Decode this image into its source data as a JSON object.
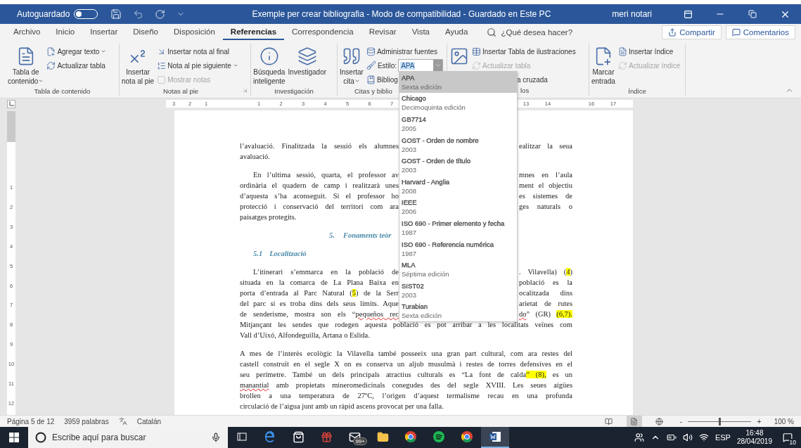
{
  "title_bar": {
    "autosave_label": "Autoguardado",
    "autosave_on": false,
    "undo_disabled": true,
    "title": "Exemple per crear bibliografia - Modo de compatibilidad - Guardado en Este PC",
    "user": "meri notari"
  },
  "menu_tabs": [
    {
      "label": "Archivo",
      "selected": false
    },
    {
      "label": "Inicio",
      "selected": false
    },
    {
      "label": "Insertar",
      "selected": false
    },
    {
      "label": "Diseño",
      "selected": false
    },
    {
      "label": "Disposición",
      "selected": false
    },
    {
      "label": "Referencias",
      "selected": true
    },
    {
      "label": "Correspondencia",
      "selected": false
    },
    {
      "label": "Revisar",
      "selected": false
    },
    {
      "label": "Vista",
      "selected": false
    },
    {
      "label": "Ayuda",
      "selected": false
    }
  ],
  "search": {
    "placeholder": "¿Qué desea hacer?"
  },
  "share_button": "Compartir",
  "comments_button": "Comentarios",
  "ribbon_groups": [
    {
      "label": "Tabla de contenido",
      "launcher": false,
      "items": [
        {
          "kind": "large",
          "lines": [
            "Tabla de",
            "contenido"
          ],
          "dropdown": true
        },
        {
          "kind": "stack",
          "buttons": [
            {
              "kind": "button",
              "label": "Agregar texto",
              "dropdown": true,
              "disabled": false
            },
            {
              "kind": "button",
              "label": "Actualizar tabla",
              "dropdown": false,
              "disabled": false
            }
          ]
        }
      ]
    },
    {
      "label": "Notas al pie",
      "launcher": true,
      "items": [
        {
          "kind": "large",
          "lines": [
            "Insertar",
            "nota al pie"
          ],
          "dropdown": false
        },
        {
          "kind": "stack",
          "buttons": [
            {
              "kind": "button",
              "label": "Insertar nota al final",
              "dropdown": false,
              "disabled": false
            },
            {
              "kind": "button",
              "label": "Nota al pie siguiente",
              "dropdown": true,
              "disabled": false
            },
            {
              "kind": "button",
              "label": "Mostrar notas",
              "dropdown": false,
              "disabled": true
            }
          ]
        }
      ]
    },
    {
      "label": "Investigación",
      "launcher": false,
      "items": [
        {
          "kind": "large",
          "lines": [
            "Búsqueda",
            "inteligente"
          ],
          "dropdown": false
        },
        {
          "kind": "large",
          "lines": [
            "Investigador"
          ],
          "dropdown": false
        }
      ]
    },
    {
      "label": "Citas y biblio",
      "launcher": false,
      "items": [
        {
          "kind": "large",
          "lines": [
            "Insertar",
            "cita"
          ],
          "dropdown": true
        },
        {
          "kind": "stack",
          "buttons": [
            {
              "kind": "button",
              "label": "Administrar fuentes",
              "dropdown": false,
              "disabled": false
            },
            {
              "kind": "style",
              "label": "Estilo:",
              "value": "APA",
              "expanded": true,
              "options": [
                {
                  "name": "APA",
                  "detail": "Sexta edición",
                  "selected": true
                },
                {
                  "name": "Chicago",
                  "detail": "Decimoquinta edición",
                  "selected": false
                },
                {
                  "name": "GB7714",
                  "detail": "2005",
                  "selected": false
                },
                {
                  "name": "GOST - Orden de nombre",
                  "detail": "2003",
                  "selected": false
                },
                {
                  "name": "GOST - Orden de título",
                  "detail": "2003",
                  "selected": false
                },
                {
                  "name": "Harvard - Anglia",
                  "detail": "2008",
                  "selected": false
                },
                {
                  "name": "IEEE",
                  "detail": "2006",
                  "selected": false
                },
                {
                  "name": "ISO 690 - Primer elemento y fecha",
                  "detail": "1987",
                  "selected": false
                },
                {
                  "name": "ISO 690 - Referencia numérica",
                  "detail": "1987",
                  "selected": false
                },
                {
                  "name": "MLA",
                  "detail": "Séptima edición",
                  "selected": false
                },
                {
                  "name": "SIST02",
                  "detail": "2003",
                  "selected": false
                },
                {
                  "name": "Turabian",
                  "detail": "Sexta edición",
                  "selected": false
                }
              ]
            },
            {
              "kind": "button",
              "label": "Bibliog",
              "disabled": false
            }
          ]
        }
      ]
    },
    {
      "label": "los",
      "launcher": false,
      "items": [
        {
          "kind": "large"
        },
        {
          "kind": "stack",
          "buttons": [
            {
              "kind": "button",
              "label": "Insertar Tabla de ilustraciones",
              "dropdown": false,
              "disabled": false
            },
            {
              "kind": "button",
              "label": "Actualizar tabla",
              "dropdown": false,
              "disabled": true
            },
            {
              "kind": "clipped",
              "label": "a cruzada",
              "dropdown": false,
              "disabled": false
            }
          ]
        }
      ]
    },
    {
      "label": "Índice",
      "launcher": false,
      "items": [
        {
          "kind": "large",
          "lines": [
            "Marcar",
            "entrada"
          ],
          "dropdown": false
        },
        {
          "kind": "stack",
          "buttons": [
            {
              "kind": "button",
              "label": "Insertar índice",
              "dropdown": false,
              "disabled": false
            },
            {
              "kind": "button",
              "label": "Actualizar índice",
              "dropdown": false,
              "disabled": true
            }
          ]
        }
      ]
    }
  ],
  "ruler": [
    [
      "3",
      "2",
      "1"
    ],
    [
      "1",
      "2",
      "3",
      "4",
      "5",
      "6",
      "7"
    ],
    [
      "13",
      "14"
    ],
    [
      "16",
      "17"
    ]
  ],
  "vertical_ruler": [
    "1",
    "2",
    "3",
    "4",
    "5",
    "6",
    "7",
    "8",
    "9",
    "10",
    "11",
    "12"
  ],
  "document": [
    {
      "kind": "paragraph",
      "indented": false,
      "lines": [
        {
          "left": [
            {
              "kind": "plain",
              "text": "l’avaluació. Finalitzada la sessió els alumnes"
            }
          ],
          "right": [
            {
              "kind": "plain",
              "text": "ealitzar la seua"
            }
          ]
        },
        {
          "left": [
            {
              "kind": "plain",
              "text": "avaluació."
            }
          ]
        }
      ]
    },
    {
      "kind": "paragraph",
      "indented": true,
      "lines": [
        {
          "left": [
            {
              "kind": "plain",
              "text": "En l’ultima sessió, quarta, el professor av"
            }
          ],
          "right": [
            {
              "kind": "plain",
              "text": "mnes en l’aula"
            }
          ]
        },
        {
          "left": [
            {
              "kind": "plain",
              "text": "ordinària el quadern de camp i realitzarà unes"
            }
          ],
          "right": [
            {
              "kind": "plain",
              "text": "ment el objectiu"
            }
          ]
        },
        {
          "left": [
            {
              "kind": "plain",
              "text": "d’aquesta s’ha aconseguit. Si el professor ho"
            }
          ],
          "right": [
            {
              "kind": "plain",
              "text": "es sistemes de"
            }
          ]
        },
        {
          "left": [
            {
              "kind": "plain",
              "text": "protecció i conservació del territori com ara"
            }
          ],
          "right": [
            {
              "kind": "plain",
              "text": "ges naturals o"
            }
          ]
        },
        {
          "left": [
            {
              "kind": "plain",
              "text": "paisatges protegits."
            }
          ]
        }
      ]
    },
    {
      "kind": "chapter",
      "number": "5.",
      "text": "Fonaments teòr"
    },
    {
      "kind": "section",
      "number": "5.1",
      "text": "Localització"
    },
    {
      "kind": "paragraph",
      "indented": true,
      "lines": [
        {
          "left": [
            {
              "kind": "plain",
              "text": "L’itinerari s’emmarca en la població de"
            }
          ],
          "right": [
            {
              "kind": "plain",
              "text": ". Vilavella) ("
            },
            {
              "kind": "highlight",
              "text": "4"
            },
            {
              "kind": "plain",
              "text": ")"
            }
          ]
        },
        {
          "left": [
            {
              "kind": "plain",
              "text": "situada en la comarca de La Plana Baixa en"
            }
          ],
          "right": [
            {
              "kind": "plain",
              "text": "població es la"
            }
          ]
        },
        {
          "left": [
            {
              "kind": "plain",
              "text": "porta d’entrada al Parc Natural ("
            },
            {
              "kind": "highlight",
              "text": "5"
            },
            {
              "kind": "plain",
              "text": ") de la Serr"
            }
          ],
          "right": [
            {
              "kind": "plain",
              "text": "ocalitzada dins"
            }
          ]
        },
        {
          "left": [
            {
              "kind": "plain",
              "text": "del parc si es troba dins dels seus límits. Aque"
            }
          ],
          "right": [
            {
              "kind": "plain",
              "text": "arietat de rutes"
            }
          ]
        },
        {
          "left": [
            {
              "kind": "plain",
              "text": "de senderisme, mostra son els “"
            },
            {
              "kind": "misspelled",
              "text": "pequeños rec"
            }
          ],
          "right": [
            {
              "kind": "misspelled",
              "text": "do"
            },
            {
              "kind": "plain",
              "text": "” (GR) "
            },
            {
              "kind": "highlight",
              "text": "(6,7)."
            }
          ]
        },
        {
          "left": [
            {
              "kind": "plain",
              "text": "Mitjançant les sendes que rodegen aquesta població es pot arribar a les localitats veïnes com"
            }
          ]
        },
        {
          "left": [
            {
              "kind": "plain",
              "text": "Vall d’Uixó, Alfondeguilla, Artana o Eslida."
            }
          ]
        }
      ]
    },
    {
      "kind": "paragraph",
      "indented": false,
      "lines": [
        {
          "left": [
            {
              "kind": "plain",
              "text": "A mes de l’interès ecològic la Vilavella també posseeix una gran part cultural, com ara restes del"
            }
          ]
        },
        {
          "left": [
            {
              "kind": "plain",
              "text": "castell construït en el segle X on es conserva un aljub musulmà i restes de torres defensives en el"
            }
          ]
        },
        {
          "left": [
            {
              "kind": "plain",
              "text": "seu perímetre. També un dels principals atractius culturals es “La font de calda"
            },
            {
              "kind": "highlight",
              "text": "” (8),"
            },
            {
              "kind": "plain",
              "text": " es un"
            }
          ]
        },
        {
          "left": [
            {
              "kind": "misspelled",
              "text": "manantial"
            },
            {
              "kind": "plain",
              "text": " amb propietats mineromedicinals conegudes des del segle XVIII. Les seues aigües"
            }
          ]
        },
        {
          "left": [
            {
              "kind": "plain",
              "text": "brollen a una temperatura de 27ºC, l’origen d’aquest termalisme recau en una profunda"
            }
          ]
        },
        {
          "left": [
            {
              "kind": "plain",
              "text": "circulació de l’aigua junt amb un ràpid ascens provocat per una falla."
            }
          ]
        }
      ]
    }
  ],
  "status_bar": {
    "page": "Página 5 de 12",
    "words": "3959 palabras",
    "language": "Catalán",
    "views": [
      {
        "selected": false
      },
      {
        "selected": true
      },
      {
        "selected": false
      }
    ],
    "zoom_out": "-",
    "zoom_in": "+",
    "zoom_level": {
      "level": 0.5
    },
    "zoom_value": "100 %"
  },
  "taskbar": {
    "search_placeholder": "Escribe aquí para buscar",
    "apps": [
      {
        "kind": "task-view",
        "selected": false
      },
      {
        "kind": "e-browser",
        "selected": false
      },
      {
        "kind": "store",
        "selected": false
      },
      {
        "kind": "gift",
        "selected": false
      },
      {
        "kind": "mail",
        "selected": false,
        "badge": "99+"
      },
      {
        "kind": "folder",
        "selected": false
      },
      {
        "kind": "circle-browser",
        "selected": false
      },
      {
        "kind": "music",
        "selected": false
      },
      {
        "kind": "circle-browser",
        "selected": false
      },
      {
        "kind": "word",
        "selected": true
      }
    ],
    "language": "ESP",
    "time": "16:48",
    "date": "28/04/2019",
    "notifications": "10"
  }
}
